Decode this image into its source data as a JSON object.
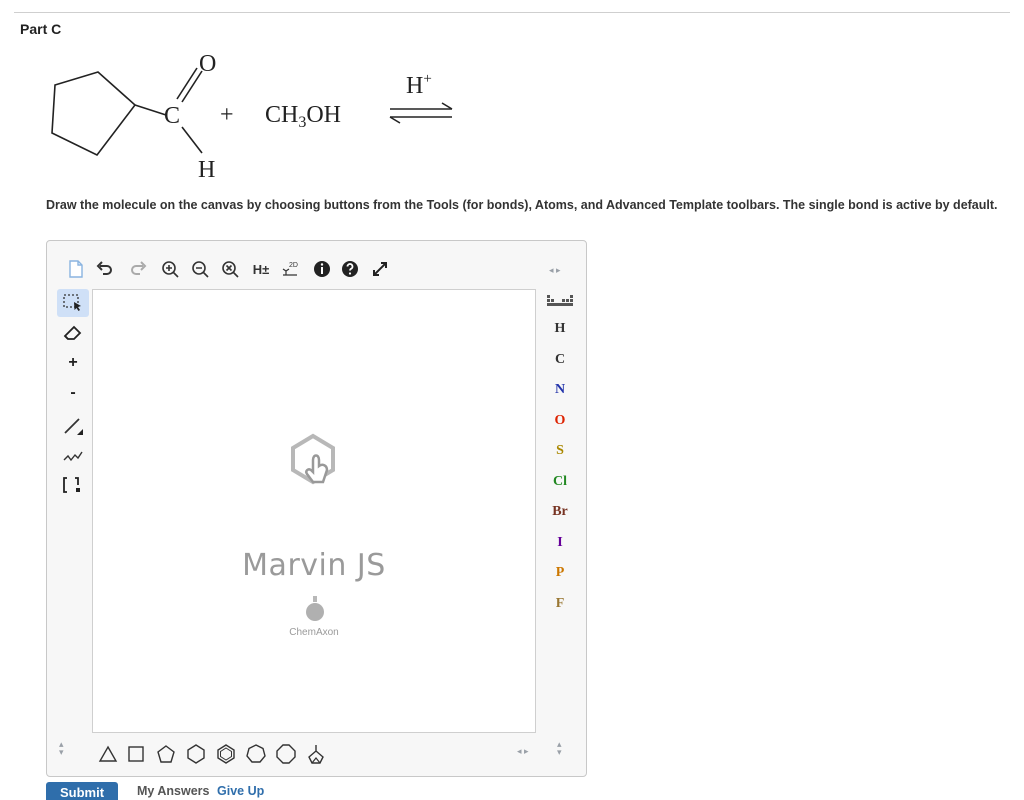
{
  "part": {
    "title": "Part C"
  },
  "reaction": {
    "oxygen": "O",
    "carbon": "C",
    "hydrogen": "H",
    "plus": "+",
    "reagent_main": "CH",
    "reagent_sub": "3",
    "reagent_tail": "OH",
    "catalyst": "H",
    "catalyst_sup": "+"
  },
  "instructions": "Draw the molecule on the canvas by choosing buttons from the Tools (for bonds), Atoms, and Advanced Template toolbars. The single bond is active by default.",
  "editor": {
    "toolbar": {
      "hydrogen_toggle": "H±",
      "clean_label": "2D"
    },
    "canvas": {
      "logo_text": "Marvin JS",
      "vendor_text": "ChemAxon"
    },
    "left_tools": {
      "increase_charge": "+",
      "decrease_charge": "-"
    },
    "atoms": [
      {
        "symbol": "H",
        "color": "#333333"
      },
      {
        "symbol": "C",
        "color": "#333333"
      },
      {
        "symbol": "N",
        "color": "#2233aa"
      },
      {
        "symbol": "O",
        "color": "#dd2200"
      },
      {
        "symbol": "S",
        "color": "#aa8800"
      },
      {
        "symbol": "Cl",
        "color": "#228822"
      },
      {
        "symbol": "Br",
        "color": "#773322"
      },
      {
        "symbol": "I",
        "color": "#660099"
      },
      {
        "symbol": "P",
        "color": "#cc7700"
      },
      {
        "symbol": "F",
        "color": "#997733"
      }
    ]
  },
  "actions": {
    "submit": "Submit",
    "my_answers": "My Answers",
    "give_up": "Give Up"
  }
}
